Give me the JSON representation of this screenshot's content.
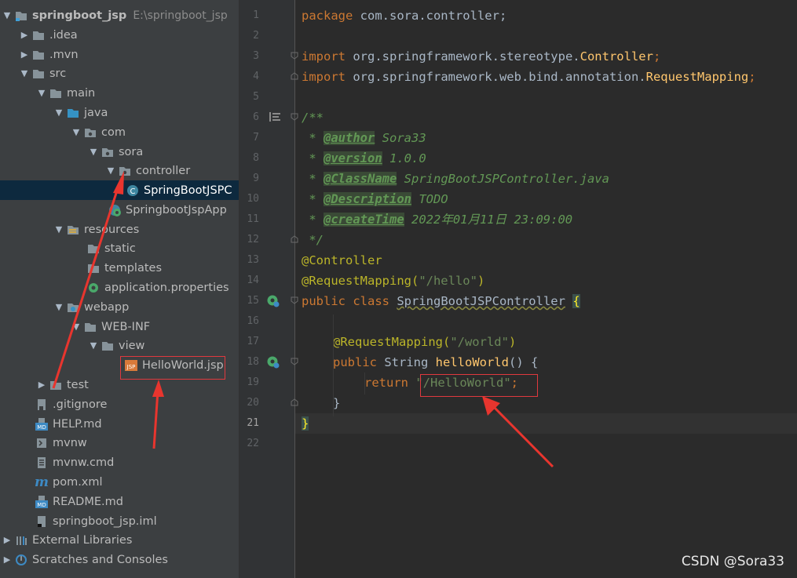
{
  "project": {
    "root_name": "springboot_jsp",
    "root_path": "E:\\springboot_jsp"
  },
  "tree": {
    "idea": ".idea",
    "mvn": ".mvn",
    "src": "src",
    "main": "main",
    "java": "java",
    "com": "com",
    "sora": "sora",
    "controller": "controller",
    "controller_class": "SpringBootJSPC",
    "app_class": "SpringbootJspApp",
    "resources": "resources",
    "static": "static",
    "templates": "templates",
    "app_props": "application.properties",
    "webapp": "webapp",
    "webinf": "WEB-INF",
    "view": "view",
    "jsp": "HelloWorld.jsp",
    "test": "test",
    "gitignore": ".gitignore",
    "help": "HELP.md",
    "mvnw": "mvnw",
    "mvnwcmd": "mvnw.cmd",
    "pom": "pom.xml",
    "readme": "README.md",
    "iml": "springboot_jsp.iml",
    "ext_libs": "External Libraries",
    "scratches": "Scratches and Consoles",
    "icon_labels": {
      "md": "MD",
      "jsp": "JSP",
      "m": "m",
      "c": "C"
    }
  },
  "editor": {
    "line_numbers": [
      "1",
      "2",
      "3",
      "4",
      "5",
      "6",
      "7",
      "8",
      "9",
      "10",
      "11",
      "12",
      "13",
      "14",
      "15",
      "16",
      "17",
      "18",
      "19",
      "20",
      "21",
      "22"
    ],
    "current_line": "21",
    "code": {
      "l1_kw": "package",
      "l1_rest": " com.sora.controller;",
      "l3_kw": "import",
      "l3_pkg": " org.springframework.stereotype.",
      "l3_cls": "Controller",
      "l3_semi": ";",
      "l4_kw": "import",
      "l4_pkg": " org.springframework.web.bind.annotation.",
      "l4_cls": "RequestMapping",
      "l4_semi": ";",
      "l6": "/**",
      "l7_prefix": " * ",
      "l7_tag": "@author",
      "l7_val": " Sora33",
      "l8_prefix": " * ",
      "l8_tag": "@version",
      "l8_val": " 1.0.0",
      "l9_prefix": " * ",
      "l9_tag": "@ClassName",
      "l9_val": " SpringBootJSPController.java",
      "l10_prefix": " * ",
      "l10_tag": "@Description",
      "l10_val": " TODO",
      "l11_prefix": " * ",
      "l11_tag": "@createTime",
      "l11_val": " 2022年01月11日 23:09:00",
      "l12": " */",
      "l13": "@Controller",
      "l14_ann": "@RequestMapping(",
      "l14_str": "\"/hello\"",
      "l14_end": ")",
      "l15_kw": "public class ",
      "l15_cls": "SpringBootJSPController",
      "l15_brace": "{",
      "l17_ann": "@RequestMapping(",
      "l17_str": "\"/world\"",
      "l17_end": ")",
      "l18_kw": "public",
      "l18_type": " String ",
      "l18_fn": "helloWorld",
      "l18_end": "() {",
      "l19_kw": "return",
      "l19_str": "\"/HelloWorld\"",
      "l19_semi": ";",
      "l20": "}",
      "l21": "}"
    }
  },
  "watermark": "CSDN @Sora33",
  "colors": {
    "tree_bg": "#3c3f41",
    "editor_bg": "#2b2b2b",
    "keyword": "#cc7832",
    "string": "#6a8759",
    "annotation": "#bbb529",
    "highlight_box": "#e0393e"
  }
}
